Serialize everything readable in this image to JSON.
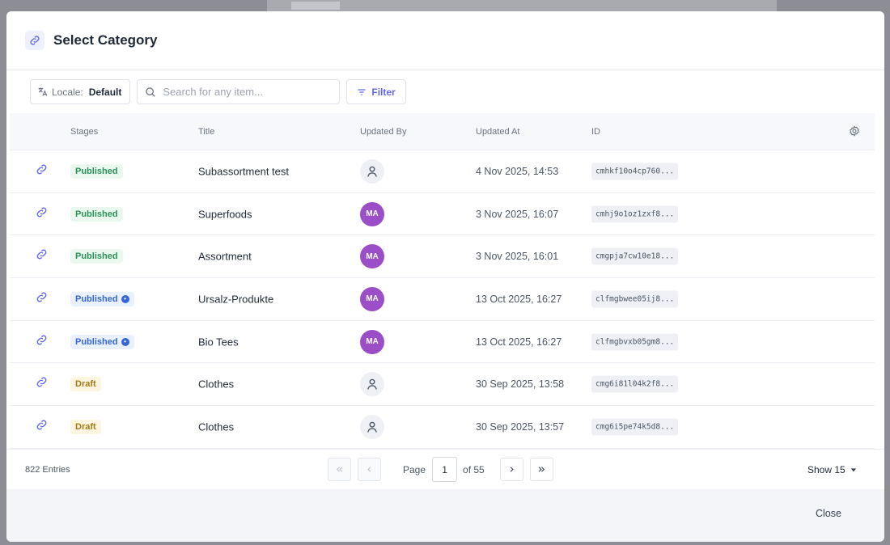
{
  "modal": {
    "title": "Select Category"
  },
  "toolbar": {
    "locale_label": "Locale:",
    "locale_value": "Default",
    "search_placeholder": "Search for any item...",
    "filter_label": "Filter"
  },
  "table": {
    "columns": [
      "Stages",
      "Title",
      "Updated By",
      "Updated At",
      "ID"
    ],
    "rows": [
      {
        "stage": "Published",
        "stage_info": false,
        "title": "Subassortment test",
        "updated_by": "",
        "avatar": "user-icon",
        "updated_at": "4 Nov 2025, 14:53",
        "id": "cmhkf10o4cp760..."
      },
      {
        "stage": "Published",
        "stage_info": false,
        "title": "Superfoods",
        "updated_by": "MA",
        "avatar": "initials",
        "updated_at": "3 Nov 2025, 16:07",
        "id": "cmhj9o1oz1zxf8..."
      },
      {
        "stage": "Published",
        "stage_info": false,
        "title": "Assortment",
        "updated_by": "MA",
        "avatar": "initials",
        "updated_at": "3 Nov 2025, 16:01",
        "id": "cmgpja7cw10e18..."
      },
      {
        "stage": "Published",
        "stage_info": true,
        "title": "Ursalz-Produkte",
        "updated_by": "MA",
        "avatar": "initials",
        "updated_at": "13 Oct 2025, 16:27",
        "id": "clfmgbwee05ij8..."
      },
      {
        "stage": "Published",
        "stage_info": true,
        "title": "Bio Tees",
        "updated_by": "MA",
        "avatar": "initials",
        "updated_at": "13 Oct 2025, 16:27",
        "id": "clfmgbvxb05gm8..."
      },
      {
        "stage": "Draft",
        "stage_info": false,
        "title": "Clothes",
        "updated_by": "",
        "avatar": "user-icon",
        "updated_at": "30 Sep 2025, 13:58",
        "id": "cmg6i81l04k2f8..."
      },
      {
        "stage": "Draft",
        "stage_info": false,
        "title": "Clothes",
        "updated_by": "",
        "avatar": "user-icon",
        "updated_at": "30 Sep 2025, 13:57",
        "id": "cmg6i5pe74k5d8..."
      }
    ]
  },
  "pagination": {
    "entries": "822 Entries",
    "page_label": "Page",
    "current_page": "1",
    "of_label": "of 55",
    "show_label": "Show 15"
  },
  "footer": {
    "close_label": "Close"
  },
  "colors": {
    "accent": "#6366f1",
    "avatar_bg": "#9b4ec7",
    "published": "#2a9158",
    "published_info": "#3566d6",
    "draft": "#a47a17"
  }
}
